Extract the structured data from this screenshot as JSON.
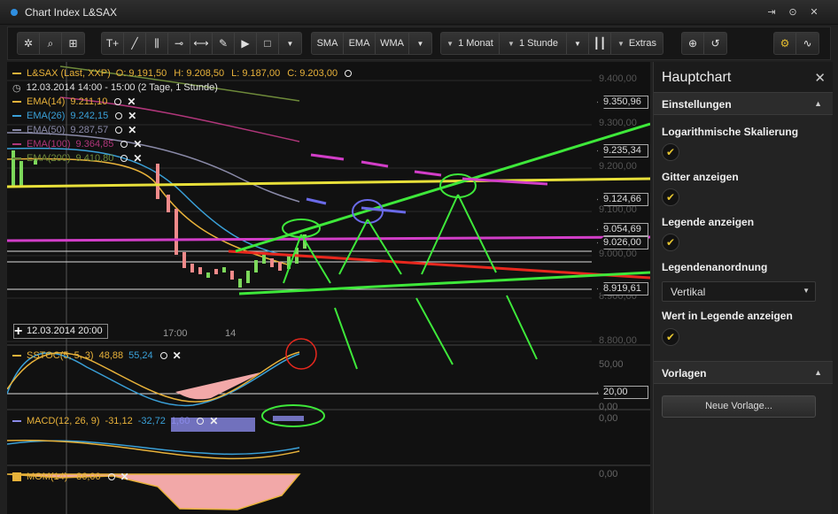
{
  "window": {
    "title": "Chart Index L&SAX"
  },
  "toolbar": {
    "draw_buttons": [
      "T+",
      "╱",
      "⫼",
      "⊸",
      "⟷",
      "✎",
      "▶",
      "□"
    ],
    "indicators": [
      "SMA",
      "EMA",
      "WMA"
    ],
    "period_label": "1 Monat",
    "interval_label": "1 Stunde",
    "extras_label": "Extras"
  },
  "legend": {
    "main": {
      "label": "L&SAX (Last, XXP)",
      "open": "O: 9.191,50",
      "high": "H: 9.208,50",
      "low": "L: 9.187,00",
      "close": "C: 9.203,00"
    },
    "date_range": "12.03.2014 14:00 - 15:00 (2 Tage, 1 Stunde)",
    "indicators": [
      {
        "label": "EMA(14)",
        "value": "9.211,10",
        "color": "#e8b23a"
      },
      {
        "label": "EMA(26)",
        "value": "9.242,15",
        "color": "#3aa0d8"
      },
      {
        "label": "EMA(50)",
        "value": "9.287,57",
        "color": "#8a8aa8"
      },
      {
        "label": "EMA(100)",
        "value": "9.364,85",
        "color": "#b0367a"
      },
      {
        "label": "EMA(200)",
        "value": "9.410,80",
        "color": "#6e8a3a"
      }
    ]
  },
  "y_axis": {
    "labels": [
      "9.400,00",
      "9.300,00",
      "9.200,00",
      "9.100,00",
      "9.000,00",
      "8.900,00",
      "8.800,00"
    ],
    "tags": [
      "9.350,96",
      "9.235,34",
      "9.124,66",
      "9.054,69",
      "9.026,00",
      "8.919,61"
    ]
  },
  "x_axis": {
    "ticks": [
      "17:00",
      "14"
    ],
    "crosshair_label": "12.03.2014 20:00"
  },
  "sub_panels": {
    "sstoc": {
      "label": "SSTOC(5, 5, 3)",
      "v1": "48,88",
      "v2": "55,24",
      "axis": [
        "50,00",
        "0,00"
      ],
      "tag": "20,00"
    },
    "macd": {
      "label": "MACD(12, 26, 9)",
      "v1": "-31,12",
      "v2": "-32,72",
      "v3": "1,60",
      "axis": [
        "0,00"
      ]
    },
    "mom": {
      "label": "MOM(14)",
      "v1": "-86,00",
      "axis": [
        "0,00"
      ]
    }
  },
  "panel": {
    "title": "Hauptchart",
    "section_settings": "Einstellungen",
    "opt_log": "Logarithmische Skalierung",
    "opt_grid": "Gitter anzeigen",
    "opt_legend": "Legende anzeigen",
    "opt_legend_pos": "Legendenanordnung",
    "legend_pos_value": "Vertikal",
    "opt_value_in_legend": "Wert in Legende anzeigen",
    "section_templates": "Vorlagen",
    "new_template": "Neue Vorlage..."
  }
}
